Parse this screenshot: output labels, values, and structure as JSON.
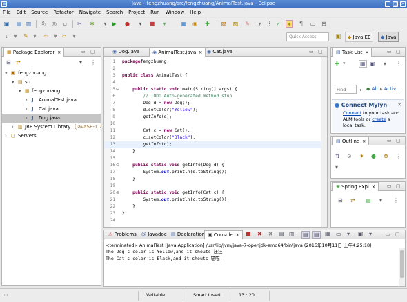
{
  "window": {
    "title": "Java - fengzhuang/src/fengzhuang/AnimalTest.java - Eclipse"
  },
  "menu": [
    "File",
    "Edit",
    "Source",
    "Refactor",
    "Navigate",
    "Search",
    "Project",
    "Run",
    "Window",
    "Help"
  ],
  "quick_access": {
    "placeholder": "Quick Access"
  },
  "perspectives": {
    "javaee": "Java EE",
    "java": "Java"
  },
  "package_explorer": {
    "title": "Package Explorer",
    "tree": [
      {
        "label": "fengzhuang",
        "indent": 0,
        "icon": "project-icon",
        "expander": "▾"
      },
      {
        "label": "src",
        "indent": 1,
        "icon": "source-folder-icon",
        "expander": "▾"
      },
      {
        "label": "fengzhuang",
        "indent": 2,
        "icon": "package-icon",
        "expander": "▾"
      },
      {
        "label": "AnimalTest.java",
        "indent": 3,
        "icon": "java-file-icon",
        "expander": "›"
      },
      {
        "label": "Cat.java",
        "indent": 3,
        "icon": "java-file-icon",
        "expander": "›"
      },
      {
        "label": "Dog.java",
        "indent": 3,
        "icon": "java-file-icon",
        "expander": "›",
        "selected": true
      },
      {
        "label": "JRE System Library",
        "suffix": " [JavaSE-1.7]",
        "indent": 1,
        "icon": "library-icon",
        "expander": "›"
      },
      {
        "label": "Servers",
        "indent": 0,
        "icon": "folder-icon",
        "expander": "›"
      }
    ]
  },
  "editor": {
    "tabs": [
      {
        "label": "Dog.java",
        "active": false
      },
      {
        "label": "AnimalTest.java",
        "active": true
      },
      {
        "label": "Cat.java",
        "active": false
      }
    ],
    "lines": [
      {
        "n": "1",
        "parts": [
          [
            "kw",
            "package"
          ],
          [
            "",
            "fengzhuang;"
          ]
        ]
      },
      {
        "n": "2",
        "parts": []
      },
      {
        "n": "3",
        "parts": [
          [
            "kw",
            "public class "
          ],
          [
            "",
            "AnimalTest {"
          ]
        ]
      },
      {
        "n": "4",
        "parts": []
      },
      {
        "n": "5",
        "fold": true,
        "parts": [
          [
            "",
            "    "
          ],
          [
            "kw",
            "public static void "
          ],
          [
            "",
            "main(String[] args) {"
          ]
        ]
      },
      {
        "n": "6",
        "parts": [
          [
            "",
            "        "
          ],
          [
            "cm",
            "// TODO Auto-generated method stub"
          ]
        ]
      },
      {
        "n": "7",
        "parts": [
          [
            "",
            "        Dog d = "
          ],
          [
            "kw",
            "new "
          ],
          [
            "",
            "Dog();"
          ]
        ]
      },
      {
        "n": "8",
        "parts": [
          [
            "",
            "        d.setColor("
          ],
          [
            "st",
            "\"Yellow\""
          ],
          [
            "",
            ");"
          ]
        ]
      },
      {
        "n": "9",
        "parts": [
          [
            "",
            "        "
          ],
          [
            "it",
            "getInfo"
          ],
          [
            "",
            "(d);"
          ]
        ]
      },
      {
        "n": "10",
        "parts": []
      },
      {
        "n": "11",
        "parts": [
          [
            "",
            "        Cat c = "
          ],
          [
            "kw",
            "new "
          ],
          [
            "",
            "Cat();"
          ]
        ]
      },
      {
        "n": "12",
        "parts": [
          [
            "",
            "        c.setColor("
          ],
          [
            "st",
            "\"Black\""
          ],
          [
            "",
            ");"
          ]
        ]
      },
      {
        "n": "13",
        "current": true,
        "parts": [
          [
            "",
            "        "
          ],
          [
            "it",
            "getInfo"
          ],
          [
            "",
            "(c);"
          ]
        ]
      },
      {
        "n": "14",
        "parts": [
          [
            "",
            "    }"
          ]
        ]
      },
      {
        "n": "15",
        "parts": []
      },
      {
        "n": "16",
        "fold": true,
        "parts": [
          [
            "",
            "    "
          ],
          [
            "kw",
            "public static void "
          ],
          [
            "",
            "getInfo(Dog d) {"
          ]
        ]
      },
      {
        "n": "17",
        "parts": [
          [
            "",
            "        System."
          ],
          [
            "itf",
            "out"
          ],
          [
            "",
            ".println(d.toString());"
          ]
        ]
      },
      {
        "n": "18",
        "parts": [
          [
            "",
            "    }"
          ]
        ]
      },
      {
        "n": "19",
        "parts": []
      },
      {
        "n": "20",
        "fold": true,
        "parts": [
          [
            "",
            "    "
          ],
          [
            "kw",
            "public static void "
          ],
          [
            "",
            "getInfo(Cat c) {"
          ]
        ]
      },
      {
        "n": "21",
        "parts": [
          [
            "",
            "        System."
          ],
          [
            "itf",
            "out"
          ],
          [
            "",
            ".println(c.toString());"
          ]
        ]
      },
      {
        "n": "22",
        "parts": [
          [
            "",
            "    }"
          ]
        ]
      },
      {
        "n": "23",
        "parts": [
          [
            "",
            "}"
          ]
        ]
      },
      {
        "n": "24",
        "parts": []
      }
    ]
  },
  "task_list": {
    "title": "Task List",
    "find_placeholder": "Find",
    "all_label": "All",
    "activate_label": "Activ..."
  },
  "mylyn": {
    "title": "Connect Mylyn",
    "connect": "Connect",
    "text1": " to your task and",
    "text2": "ALM tools or ",
    "create": "create",
    "text3": " a",
    "text4": "local task."
  },
  "outline": {
    "title": "Outline"
  },
  "spring": {
    "title": "Spring Expl"
  },
  "bottom": {
    "tabs": [
      {
        "label": "Problems",
        "active": false
      },
      {
        "label": "Javadoc",
        "active": false
      },
      {
        "label": "Declaration",
        "active": false
      },
      {
        "label": "Console",
        "active": true
      }
    ],
    "console_header": "<terminated> AnimalTest [Java Application] /usr/lib/jvm/java-7-openjdk-amd64/bin/java (2015年10月11日 上午4:25:18)",
    "console_lines": [
      "The Dog's color is Yellow,and it shouts 汪汪!",
      "The Cat's color is Black,and it shouts 喵喵!"
    ]
  },
  "status": {
    "writable": "Writable",
    "insert": "Smart Insert",
    "position": "13 : 20"
  }
}
